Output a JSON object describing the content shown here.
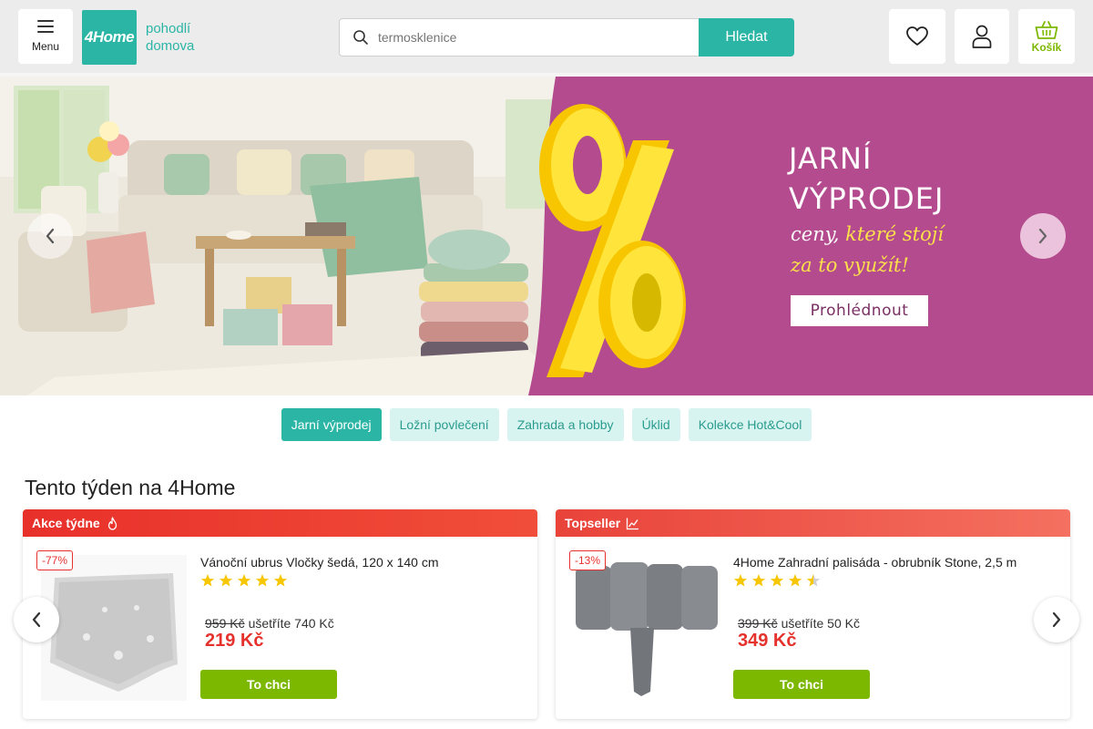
{
  "header": {
    "menu_label": "Menu",
    "logo_text": "4Home",
    "tagline_line1": "pohodlí",
    "tagline_line2": "domova",
    "search_placeholder": "termosklenice",
    "search_button": "Hledat",
    "cart_label": "Košík",
    "icons": [
      "menu-icon",
      "search-icon",
      "heart-icon",
      "user-icon",
      "basket-icon"
    ]
  },
  "banner": {
    "title_line1": "JARNÍ",
    "title_line2": "VÝPRODEJ",
    "subtitle_part1": "ceny, ",
    "subtitle_part2": "které stojí",
    "subtitle_line2": "za to využít!",
    "cta": "Prohlédnout",
    "colors": {
      "promo_bg": "#b34b8e",
      "accent_yellow": "#ffe14a"
    }
  },
  "categories": [
    {
      "label": "Jarní výprodej",
      "active": true
    },
    {
      "label": "Ložní povlečení",
      "active": false
    },
    {
      "label": "Zahrada a hobby",
      "active": false
    },
    {
      "label": "Úklid",
      "active": false
    },
    {
      "label": "Kolekce Hot&Cool",
      "active": false
    }
  ],
  "section_title": "Tento týden na 4Home",
  "products": [
    {
      "tag": "Akce týdne",
      "tag_icon": "flame-icon",
      "discount": "-77%",
      "name": "Vánoční ubrus Vločky šedá, 120 x 140 cm",
      "rating": 5,
      "old_price": "959 Kč",
      "savings": "ušetříte 740 Kč",
      "price": "219 Kč",
      "button": "To chci"
    },
    {
      "tag": "Topseller",
      "tag_icon": "trending-chart-icon",
      "discount": "-13%",
      "name": "4Home Zahradní palisáda - obrubník Stone, 2,5 m",
      "rating": 4.5,
      "old_price": "399 Kč",
      "savings": "ušetříte 50 Kč",
      "price": "349 Kč",
      "button": "To chci"
    }
  ],
  "colors": {
    "brand_teal": "#2bb5a5",
    "buy_green": "#7db800",
    "sale_red": "#e5322d",
    "star_yellow": "#f7c600"
  }
}
